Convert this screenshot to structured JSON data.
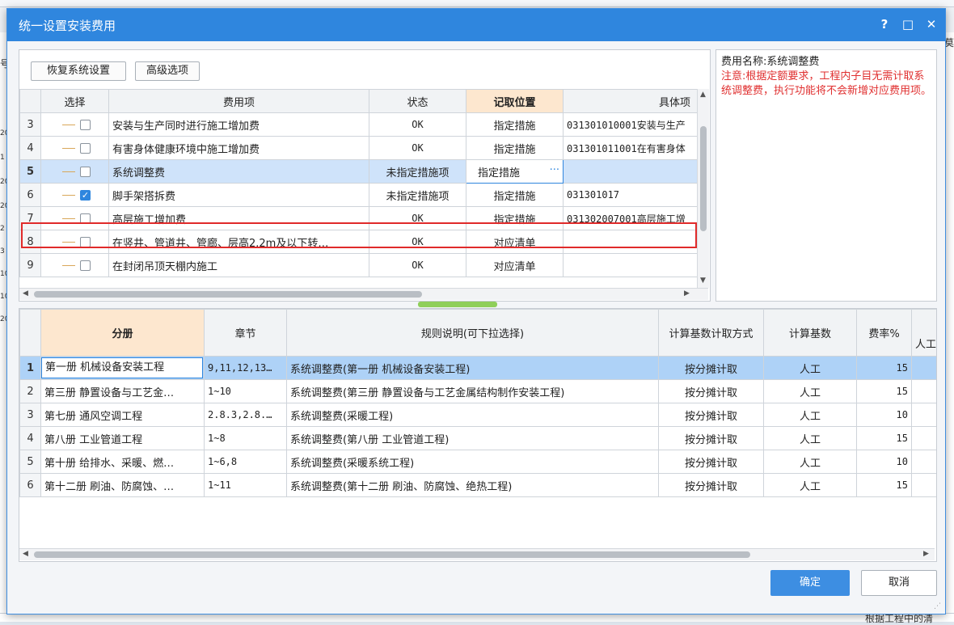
{
  "dialog": {
    "title": "统一设置安装费用",
    "help_label": "?",
    "maximize_label": "□",
    "close_label": "✕"
  },
  "toolbar": {
    "restore_label": "恢复系统设置",
    "advanced_label": "高级选项"
  },
  "top_table": {
    "columns": [
      "选择",
      "费用项",
      "状态",
      "记取位置",
      "具体项"
    ],
    "rows": [
      {
        "num": "3",
        "checked": false,
        "name": "安装与生产同时进行施工增加费",
        "status": "OK",
        "position": "指定措施",
        "item": "031301010001安装与生产"
      },
      {
        "num": "4",
        "checked": false,
        "name": "有害身体健康环境中施工增加费",
        "status": "OK",
        "position": "指定措施",
        "item": "031301011001在有害身体"
      },
      {
        "num": "5",
        "checked": false,
        "name": "系统调整费",
        "status": "未指定措施项",
        "position": "指定措施",
        "item": ""
      },
      {
        "num": "6",
        "checked": true,
        "name": "脚手架搭拆费",
        "status": "未指定措施项",
        "position": "指定措施",
        "item": "031301017"
      },
      {
        "num": "7",
        "checked": false,
        "name": "高层施工增加费",
        "status": "OK",
        "position": "指定措施",
        "item": "031302007001高层施工增"
      },
      {
        "num": "8",
        "checked": false,
        "name": "在竖井、管道井、管廊、层高2.2m及以下转…",
        "status": "OK",
        "position": "对应清单",
        "item": ""
      },
      {
        "num": "9",
        "checked": false,
        "name": "在封闭吊顶天棚内施工",
        "status": "OK",
        "position": "对应清单",
        "item": ""
      }
    ],
    "ellipsis": "···"
  },
  "info": {
    "name_line": "费用名称:系统调整费",
    "warning": "注意:根据定额要求，工程内子目无需计取系统调整费，执行功能将不会新增对应费用项。"
  },
  "bottom_table": {
    "columns": [
      "分册",
      "章节",
      "规则说明(可下拉选择)",
      "计算基数计取方式",
      "计算基数",
      "费率%",
      "人工"
    ],
    "rows": [
      {
        "num": "1",
        "book": "第一册 机械设备安装工程",
        "chapter": "9,11,12,13…",
        "rule": "系统调整费(第一册 机械设备安装工程)",
        "method": "按分摊计取",
        "base": "人工",
        "rate": "15"
      },
      {
        "num": "2",
        "book": "第三册 静置设备与工艺金…",
        "chapter": "1~10",
        "rule": "系统调整费(第三册 静置设备与工艺金属结构制作安装工程)",
        "method": "按分摊计取",
        "base": "人工",
        "rate": "15"
      },
      {
        "num": "3",
        "book": "第七册 通风空调工程",
        "chapter": "2.8.3,2.8.…",
        "rule": "系统调整费(采暖工程)",
        "method": "按分摊计取",
        "base": "人工",
        "rate": "10"
      },
      {
        "num": "4",
        "book": "第八册 工业管道工程",
        "chapter": "1~8",
        "rule": "系统调整费(第八册 工业管道工程)",
        "method": "按分摊计取",
        "base": "人工",
        "rate": "15"
      },
      {
        "num": "5",
        "book": "第十册 给排水、采暖、燃…",
        "chapter": "1~6,8",
        "rule": "系统调整费(采暖系统工程)",
        "method": "按分摊计取",
        "base": "人工",
        "rate": "10"
      },
      {
        "num": "6",
        "book": "第十二册 刷油、防腐蚀、…",
        "chapter": "1~11",
        "rule": "系统调整费(第十二册 刷油、防腐蚀、绝热工程)",
        "method": "按分摊计取",
        "base": "人工",
        "rate": "15"
      }
    ]
  },
  "footer": {
    "ok_label": "确定",
    "cancel_label": "取消"
  },
  "background": {
    "right_char": "莫",
    "bottom_text": "根据工程中的清",
    "left_marks": [
      "号",
      "20",
      "1",
      "20",
      "20",
      "2",
      "3",
      "10",
      "10",
      "20"
    ]
  }
}
